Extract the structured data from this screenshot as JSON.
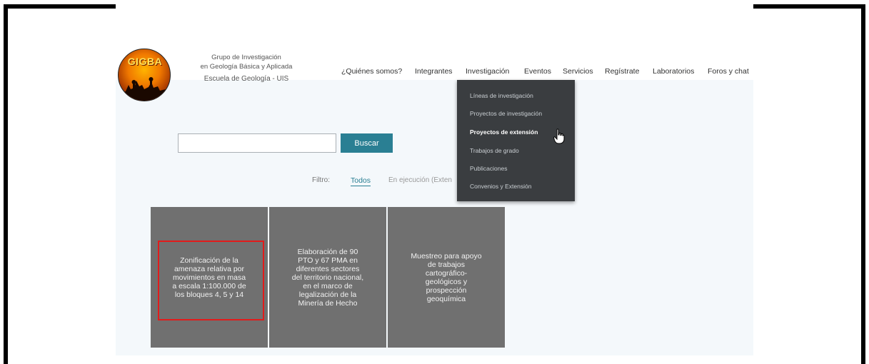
{
  "logo": {
    "text": "GIGBA"
  },
  "org": {
    "line1": "Grupo de Investigación",
    "line2": "en Geología Básica y Aplicada",
    "line3": "Escuela de Geología - UIS"
  },
  "nav": [
    {
      "label": "¿Quiénes somos?"
    },
    {
      "label": "Integrantes"
    },
    {
      "label": "Investigación"
    },
    {
      "label": "Eventos"
    },
    {
      "label": "Servicios"
    },
    {
      "label": "Regístrate"
    },
    {
      "label": "Laboratorios"
    },
    {
      "label": "Foros y chat"
    }
  ],
  "dropdown": [
    {
      "label": "Líneas de investigación"
    },
    {
      "label": "Proyectos de investigación"
    },
    {
      "label": "Proyectos de extensión",
      "active": true
    },
    {
      "label": "Trabajos de grado"
    },
    {
      "label": "Publicaciones"
    },
    {
      "label": "Convenios y Extensión"
    }
  ],
  "search": {
    "value": "",
    "placeholder": "",
    "button_label": "Buscar"
  },
  "filter": {
    "label": "Filtro:",
    "all": "Todos",
    "in_progress": "En ejecución (Exten"
  },
  "cards": [
    {
      "title": "Zonificación de la\namenaza relativa por\nmovimientos en masa\na escala 1:100.000 de\nlos bloques 4, 5 y 14"
    },
    {
      "title": "Elaboración de 90\nPTO y 67 PMA en\ndiferentes sectores\ndel territorio nacional,\nen el marco de\nlegalización de la\nMinería de Hecho"
    },
    {
      "title": "Muestreo para apoyo\nde trabajos\ncartográfico-\ngeológicos y\nprospección\ngeoquímica"
    }
  ],
  "colors": {
    "accent": "#2a7f93",
    "dropdown_bg": "#3a3d40",
    "card_bg": "#707070",
    "highlight": "#e21b1b"
  },
  "icons": {
    "cursor": "hand-pointer-icon"
  }
}
